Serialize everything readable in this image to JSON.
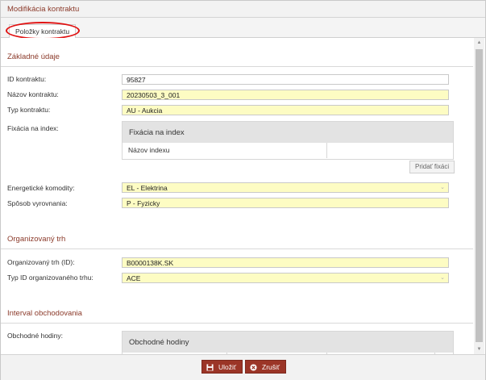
{
  "window": {
    "title": "Modifikácia kontraktu"
  },
  "tabs": [
    {
      "label": "Položky kontraktu",
      "active": true
    }
  ],
  "sections": {
    "basic": {
      "title": "Základné údaje",
      "fields": {
        "id_label": "ID kontraktu:",
        "id_value": "95827",
        "name_label": "Názov kontraktu:",
        "name_value": "20230503_3_001",
        "type_label": "Typ kontraktu:",
        "type_value": "AU - Aukcia",
        "index_label": "Fixácia na index:",
        "energy_label": "Energetické komodity:",
        "energy_value": "EL - Elektrina",
        "settle_label": "Spôsob vyrovnania:",
        "settle_value": "P - Fyzicky"
      },
      "index_table": {
        "title": "Fixácia na index",
        "column": "Názov indexu",
        "add_button": "Pridať fixáci"
      }
    },
    "market": {
      "title": "Organizovaný trh",
      "fields": {
        "id_label": "Organizovaný trh (ID):",
        "id_value": "B0000138K.SK",
        "type_label": "Typ ID organizovaného trhu:",
        "type_value": "ACE"
      }
    },
    "interval": {
      "title": "Interval obchodovania",
      "fields": {
        "hours_label": "Obchodné hodiny:"
      },
      "hours_table": {
        "title": "Obchodné hodiny"
      }
    }
  },
  "footer": {
    "save_label": "Uložiť",
    "cancel_label": "Zrušiť"
  },
  "colors": {
    "accent": "#8b3a2a",
    "button": "#9b3527",
    "required_field": "#fdfcc3",
    "highlight_ring": "#e01010"
  },
  "icons": {
    "save": "floppy-disk-icon",
    "cancel": "close-circle-icon",
    "dropdown": "chevron-down-icon"
  }
}
